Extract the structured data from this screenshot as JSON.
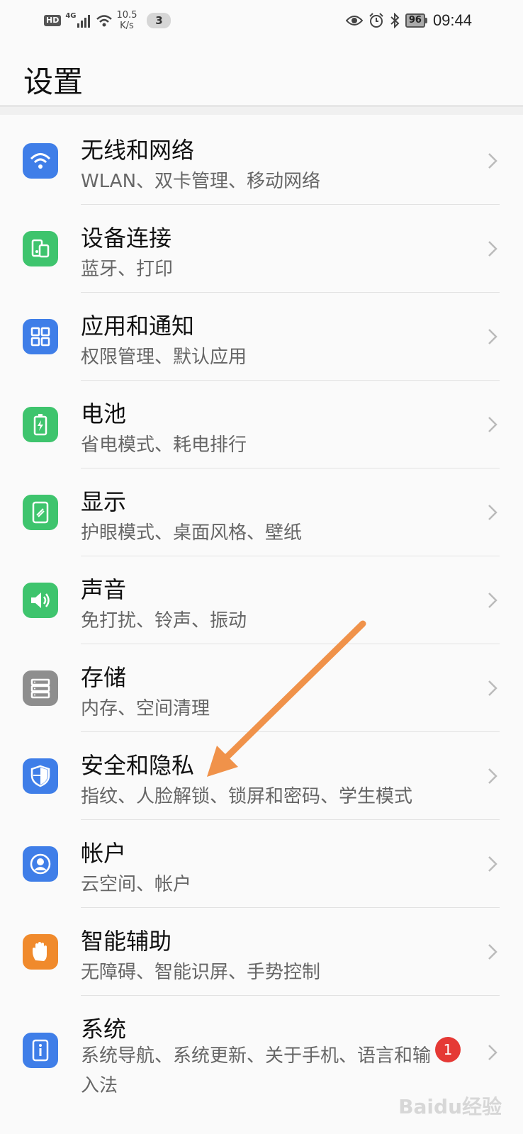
{
  "status_bar": {
    "hd": "HD",
    "network_type": "4G",
    "speed_value": "10.5",
    "speed_unit": "K/s",
    "notification_count": "3",
    "battery": "96",
    "time": "09:44"
  },
  "page": {
    "title": "设置"
  },
  "menu": [
    {
      "title": "无线和网络",
      "subtitle": "WLAN、双卡管理、移动网络",
      "icon": "wifi-icon",
      "color": "#3f7ee8"
    },
    {
      "title": "设备连接",
      "subtitle": "蓝牙、打印",
      "icon": "device-connect-icon",
      "color": "#3ec46d"
    },
    {
      "title": "应用和通知",
      "subtitle": "权限管理、默认应用",
      "icon": "apps-grid-icon",
      "color": "#3f7ee8"
    },
    {
      "title": "电池",
      "subtitle": "省电模式、耗电排行",
      "icon": "battery-icon",
      "color": "#3ec46d"
    },
    {
      "title": "显示",
      "subtitle": "护眼模式、桌面风格、壁纸",
      "icon": "display-icon",
      "color": "#3ec46d"
    },
    {
      "title": "声音",
      "subtitle": "免打扰、铃声、振动",
      "icon": "speaker-icon",
      "color": "#3ec46d"
    },
    {
      "title": "存储",
      "subtitle": "内存、空间清理",
      "icon": "storage-icon",
      "color": "#8e8e8e"
    },
    {
      "title": "安全和隐私",
      "subtitle": "指纹、人脸解锁、锁屏和密码、学生模式",
      "icon": "shield-icon",
      "color": "#3f7ee8"
    },
    {
      "title": "帐户",
      "subtitle": "云空间、帐户",
      "icon": "account-icon",
      "color": "#3f7ee8"
    },
    {
      "title": "智能辅助",
      "subtitle": "无障碍、智能识屏、手势控制",
      "icon": "hand-icon",
      "color": "#f08a2c"
    },
    {
      "title": "系统",
      "subtitle": "系统导航、系统更新、关于手机、语言和输入法",
      "icon": "system-info-icon",
      "color": "#3f7ee8",
      "badge": "1"
    }
  ],
  "annotation": {
    "color": "#f0924a"
  },
  "watermark": "Baidu经验"
}
